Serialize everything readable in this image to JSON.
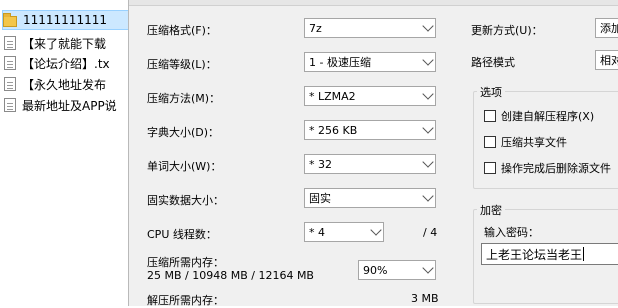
{
  "file_list": [
    {
      "name": "11111111111",
      "icon": "folder-icon",
      "selected": true
    },
    {
      "name": "【来了就能下载",
      "icon": "document-icon",
      "selected": false
    },
    {
      "name": "【论坛介绍】.tx",
      "icon": "document-icon",
      "selected": false
    },
    {
      "name": "【永久地址发布",
      "icon": "document-icon",
      "selected": false
    },
    {
      "name": "最新地址及APP说",
      "icon": "document-icon",
      "selected": false
    }
  ],
  "left": {
    "format": {
      "label": "压缩格式(F)：",
      "value": "7z"
    },
    "level": {
      "label": "压缩等级(L)：",
      "value": "1 - 极速压缩"
    },
    "method": {
      "label": "压缩方法(M)：",
      "value": "* LZMA2"
    },
    "dict": {
      "label": "字典大小(D)：",
      "value": "* 256 KB"
    },
    "word": {
      "label": "单词大小(W)：",
      "value": "* 32"
    },
    "solid": {
      "label": "固实数据大小：",
      "value": "固实"
    },
    "threads": {
      "label": "CPU 线程数：",
      "value": "* 4",
      "max": "/ 4"
    },
    "mem_compress": {
      "label": "压缩所需内存：",
      "detail": "25 MB / 10948 MB / 12164 MB",
      "value": "90%"
    },
    "mem_decompress": {
      "label": "解压所需内存：",
      "value": "3 MB"
    }
  },
  "right": {
    "update": {
      "label": "更新方式(U)：",
      "value": "添加"
    },
    "path": {
      "label": "路径模式",
      "value": "相对"
    },
    "options": {
      "title": "选项",
      "items": [
        "创建自解压程序(X)",
        "压缩共享文件",
        "操作完成后删除源文件"
      ]
    },
    "encrypt": {
      "title": "加密",
      "label": "输入密码：",
      "value": "上老王论坛当老王"
    }
  }
}
